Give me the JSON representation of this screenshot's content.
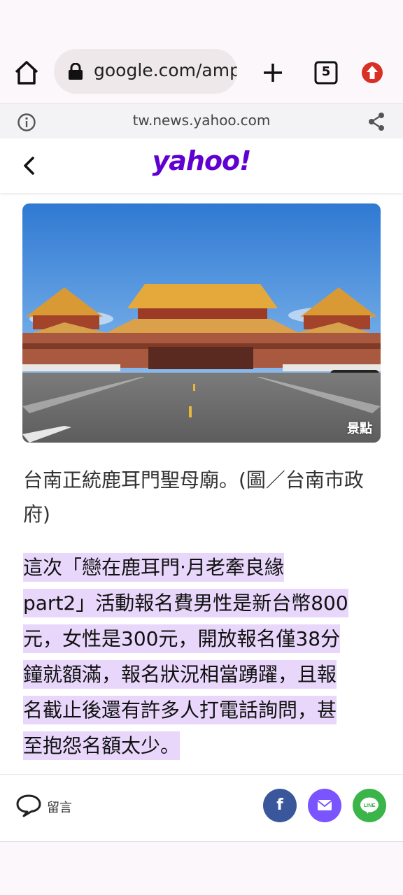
{
  "browser": {
    "url": "google.com/amp",
    "tab_count": "5",
    "host": "tw.news.yahoo.com"
  },
  "site": {
    "logo": "yahoo!"
  },
  "article": {
    "photo_watermark": "景點",
    "caption": "台南正統鹿耳門聖母廟。(圖／台南市政府)",
    "highlight_lines": [
      "這次「戀在鹿耳門‧月老牽良緣",
      "part2」活動報名費男性是新台幣800",
      "元，女性是300元，開放報名僅38分",
      "鐘就額滿，報名狀況相當踴躍，且報",
      "名截止後還有許多人打電話詢問，甚",
      "至抱怨名額太少。"
    ]
  },
  "bottom_bar": {
    "comment_label": "留言",
    "share": [
      "facebook-icon",
      "mail-icon",
      "line-icon"
    ]
  },
  "colors": {
    "yahoo_purple": "#6001d2",
    "highlight": "#e8d7fb",
    "facebook": "#39579a",
    "mail": "#7a54ff",
    "line": "#3bb54a",
    "update": "#d93025"
  }
}
